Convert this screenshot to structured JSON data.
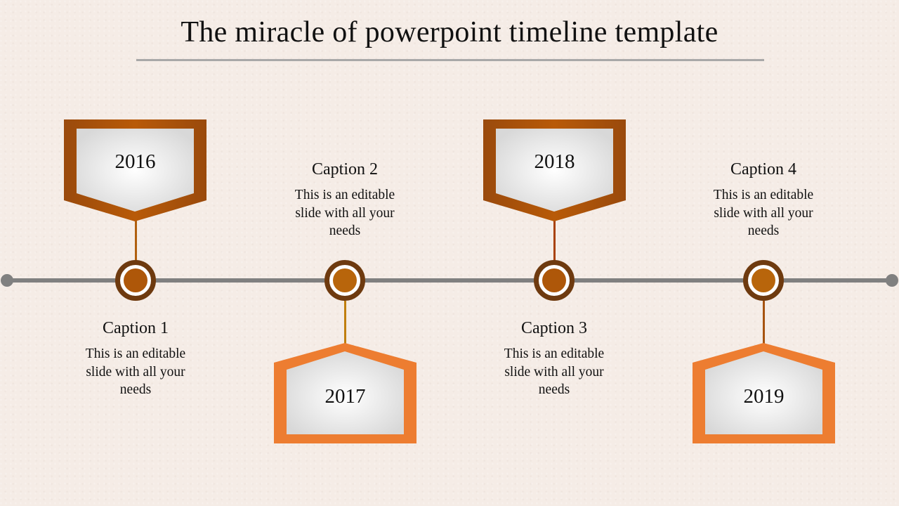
{
  "title": "The miracle of powerpoint timeline template",
  "colors": {
    "dark_orange": "#a65310",
    "light_orange": "#ed7d31",
    "node_ring": "#6e3a0f",
    "line_gray": "#808080"
  },
  "milestones": [
    {
      "year": "2016",
      "caption_title": "Caption 1",
      "caption_body": "This is an editable slide with all your needs",
      "tag_position": "above"
    },
    {
      "year": "2017",
      "caption_title": "Caption 2",
      "caption_body": "This is an editable slide with all your needs",
      "tag_position": "below"
    },
    {
      "year": "2018",
      "caption_title": "Caption 3",
      "caption_body": "This is an editable slide with all your needs",
      "tag_position": "above"
    },
    {
      "year": "2019",
      "caption_title": "Caption 4",
      "caption_body": "This is an editable slide with all your needs",
      "tag_position": "below"
    }
  ]
}
